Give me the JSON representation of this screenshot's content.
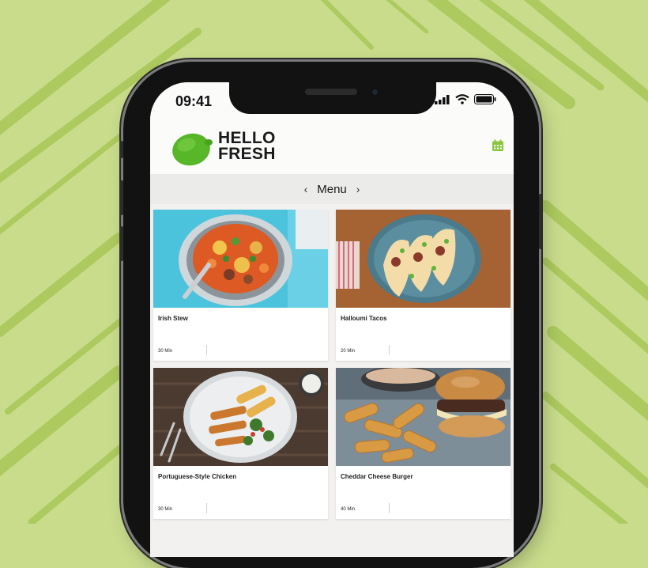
{
  "status": {
    "time": "09:41"
  },
  "brand": {
    "line1": "HELLO",
    "line2": "FRESH"
  },
  "nav": {
    "title": "Menu",
    "prev": "‹",
    "next": "›"
  },
  "icons": {
    "calendar": "calendar-icon",
    "signal": "signal-icon",
    "wifi": "wifi-icon",
    "battery": "battery-icon"
  },
  "colors": {
    "background": "#c9dc8c",
    "brand_green": "#8ac53f",
    "logo_lime": "#58b629"
  },
  "recipes": [
    {
      "title": "Irish Stew",
      "time": "30 Min"
    },
    {
      "title": "Halloumi Tacos",
      "time": "20 Min"
    },
    {
      "title": "Portuguese-Style Chicken",
      "time": "30 Min"
    },
    {
      "title": "Cheddar Cheese Burger",
      "time": "40 Min"
    }
  ]
}
